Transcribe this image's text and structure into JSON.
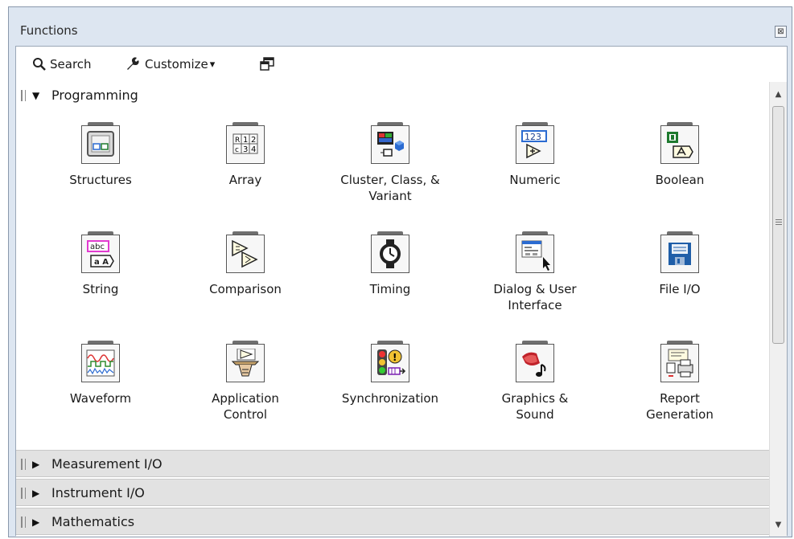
{
  "window": {
    "title": "Functions",
    "close_glyph": "⊠"
  },
  "toolbar": {
    "search_label": "Search",
    "customize_label": "Customize",
    "customize_arrow": "▾"
  },
  "categories": {
    "programming": {
      "label": "Programming",
      "state": "expanded"
    },
    "collapsed": [
      {
        "label": "Measurement I/O",
        "state": "collapsed"
      },
      {
        "label": "Instrument I/O",
        "state": "collapsed"
      },
      {
        "label": "Mathematics",
        "state": "collapsed"
      }
    ]
  },
  "items": [
    {
      "label": "Structures",
      "icon": "structures-icon"
    },
    {
      "label": "Array",
      "icon": "array-icon"
    },
    {
      "label": "Cluster, Class, & Variant",
      "label2": "Variant",
      "label1": "Cluster, Class, &",
      "icon": "cluster-icon"
    },
    {
      "label": "Numeric",
      "icon": "numeric-icon"
    },
    {
      "label": "Boolean",
      "icon": "boolean-icon"
    },
    {
      "label": "String",
      "icon": "string-icon"
    },
    {
      "label": "Comparison",
      "icon": "comparison-icon"
    },
    {
      "label": "Timing",
      "icon": "timing-icon"
    },
    {
      "label1": "Dialog & User",
      "label2": "Interface",
      "icon": "dialog-icon"
    },
    {
      "label": "File I/O",
      "icon": "file-io-icon"
    },
    {
      "label": "Waveform",
      "icon": "waveform-icon"
    },
    {
      "label1": "Application",
      "label2": "Control",
      "icon": "app-control-icon"
    },
    {
      "label": "Synchronization",
      "icon": "synchronization-icon"
    },
    {
      "label1": "Graphics &",
      "label2": "Sound",
      "icon": "graphics-sound-icon"
    },
    {
      "label1": "Report",
      "label2": "Generation",
      "icon": "report-icon"
    }
  ],
  "icon_text": {
    "array_cells": [
      "R",
      "1",
      "2",
      "c",
      "3",
      "4"
    ],
    "numeric_value": "123",
    "string_value": "abc",
    "string_sub": "a A"
  },
  "colors": {
    "accent": "#2b6bd1",
    "pink": "#e23bd0",
    "green": "#1e7a2e"
  }
}
